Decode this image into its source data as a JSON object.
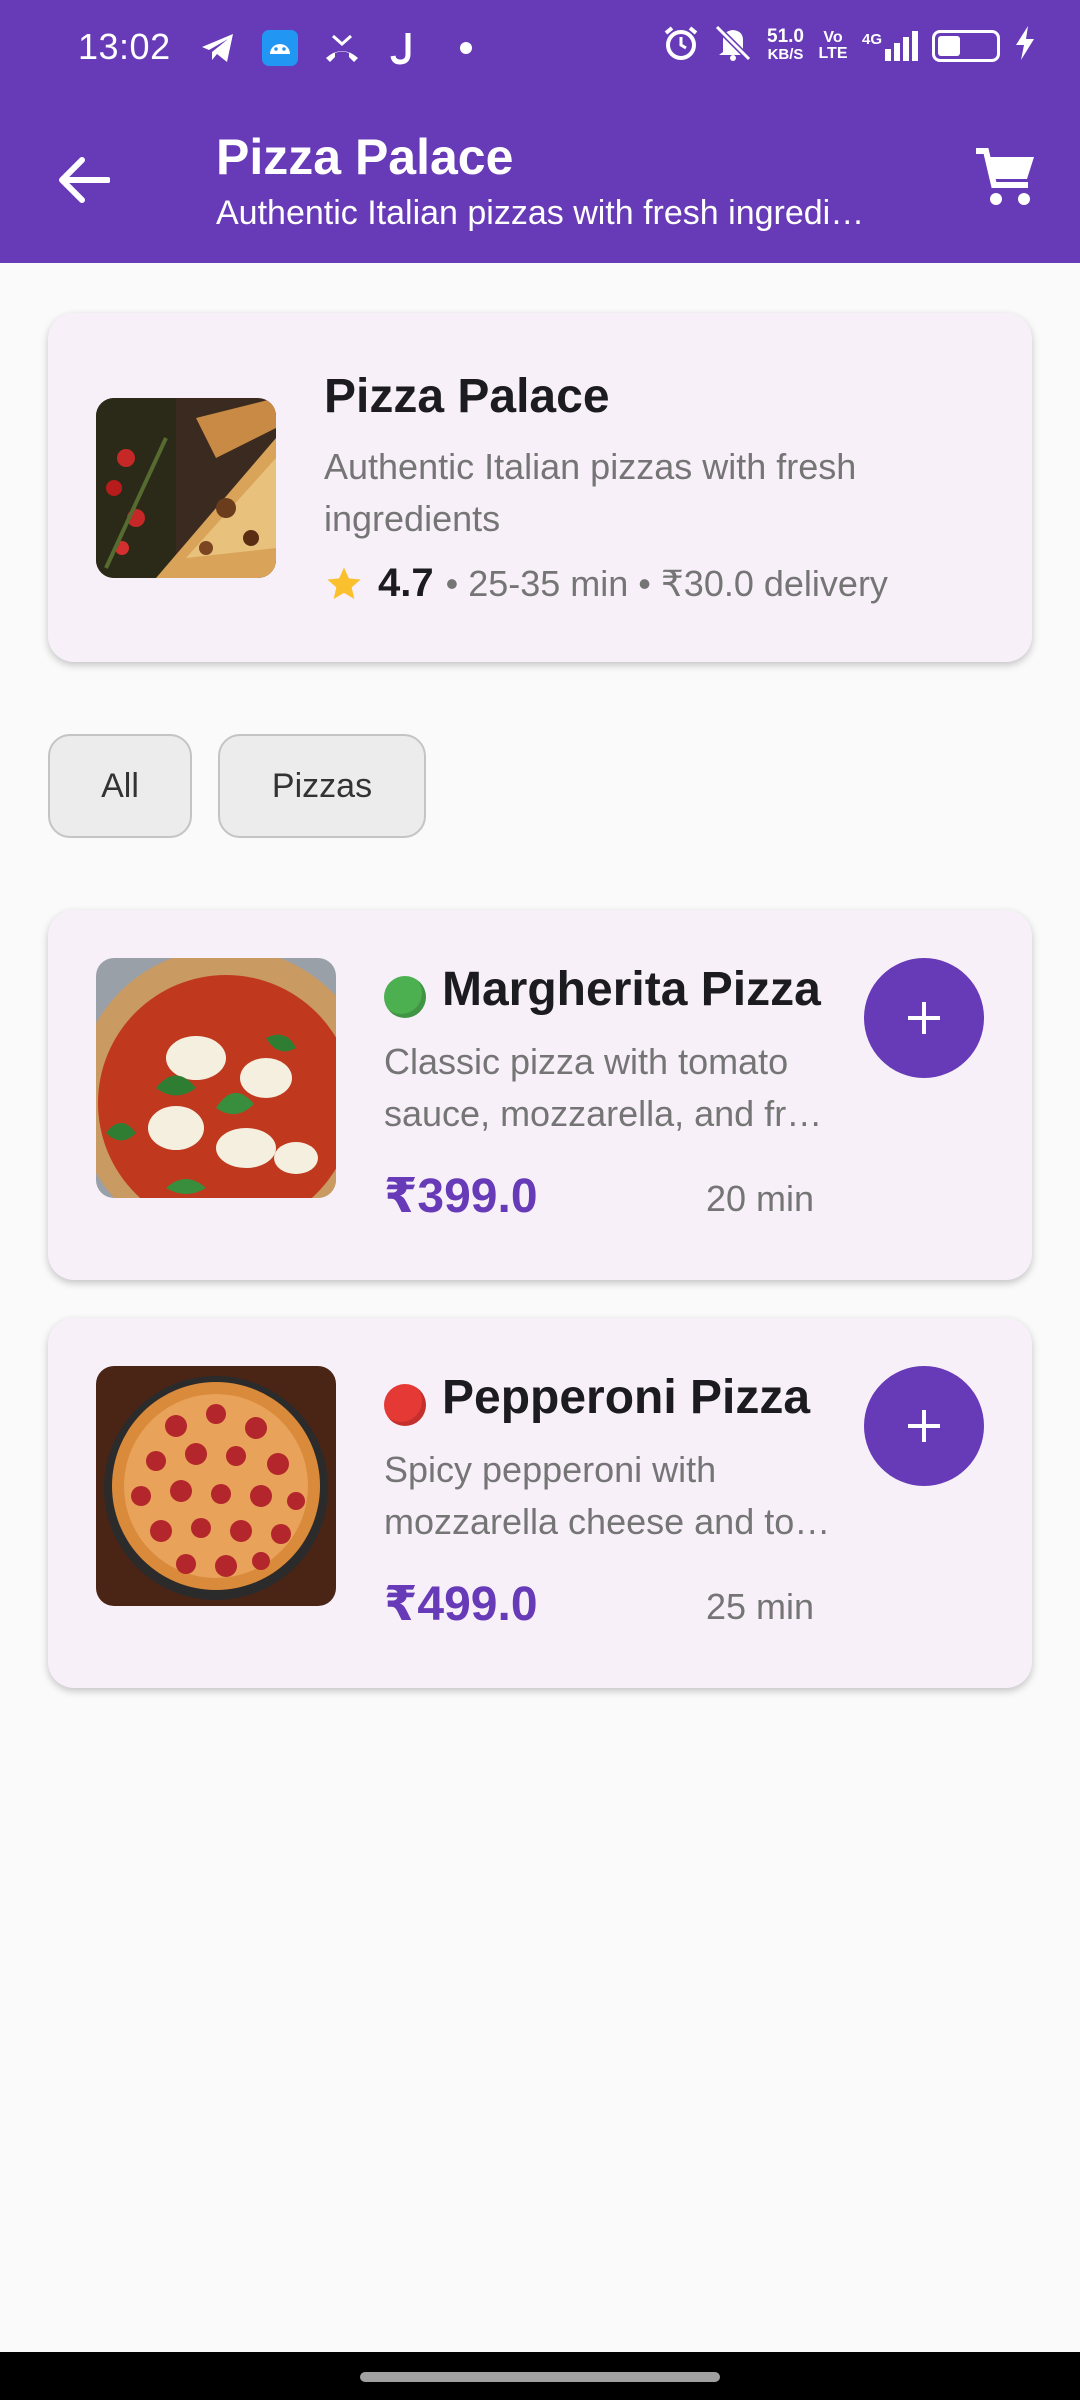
{
  "status_bar": {
    "time": "13:02",
    "left_icons": [
      "telegram-icon",
      "android-app-icon",
      "missed-call-icon",
      "j-app-icon",
      "dot-icon"
    ],
    "net_speed": "51.0",
    "net_speed_unit": "KB/S",
    "volte": "Vo LTE",
    "signal": "4G",
    "right_icons": [
      "alarm-icon",
      "mute-icon",
      "signal-icon",
      "battery-icon",
      "charging-icon"
    ]
  },
  "app_bar": {
    "title": "Pizza Palace",
    "subtitle": "Authentic Italian pizzas with fresh ingredients",
    "back_icon": "arrow-back-icon",
    "cart_icon": "shopping-cart-icon"
  },
  "restaurant": {
    "name": "Pizza Palace",
    "description": "Authentic Italian pizzas with fresh ingredients",
    "rating": "4.7",
    "meta": "• 25-35 min • ₹30.0 delivery"
  },
  "categories": [
    {
      "label": "All"
    },
    {
      "label": "Pizzas"
    }
  ],
  "menu_items": [
    {
      "name": "Margherita Pizza",
      "description_line1": "Classic pizza with tomato",
      "description_line2": "sauce, mozzarella, and fresh basil",
      "price": "₹399.0",
      "time": "20 min",
      "diet_indicator_color": "#4caf50"
    },
    {
      "name": "Pepperoni Pizza",
      "description_line1": "Spicy pepperoni with",
      "description_line2": "mozzarella cheese and tomato sauce",
      "price": "₹499.0",
      "time": "25 min",
      "diet_indicator_color": "#e53935"
    }
  ],
  "colors": {
    "primary": "#673ab7",
    "card_bg": "#f7f0f9",
    "star": "#fbc02d"
  }
}
